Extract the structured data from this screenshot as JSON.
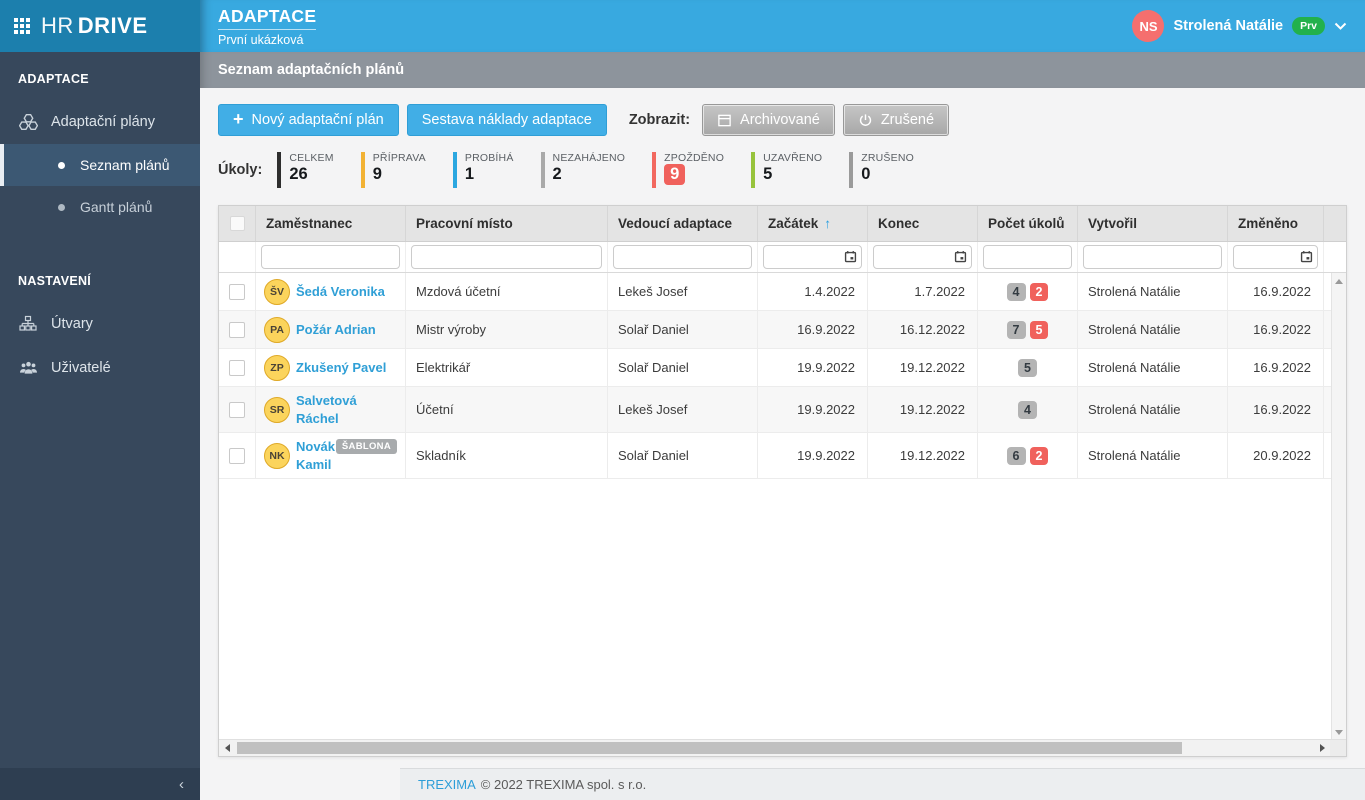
{
  "app": {
    "logo_primary": "HR",
    "logo_secondary": "DRIVE"
  },
  "sidebar": {
    "section_adaptace": "ADAPTACE",
    "item_plans": "Adaptační plány",
    "item_plan_list": "Seznam plánů",
    "item_gantt": "Gantt plánů",
    "section_nastaveni": "NASTAVENÍ",
    "item_utvary": "Útvary",
    "item_uzivatele": "Uživatelé"
  },
  "header": {
    "title": "ADAPTACE",
    "subtitle": "První ukázková",
    "user_initials": "NS",
    "user_name": "Strolená Natálie",
    "user_badge": "Prv"
  },
  "toolbar": {
    "title": "Seznam adaptačních plánů"
  },
  "actions": {
    "new_plan_icon": "+",
    "new_plan": "Nový adaptační plán",
    "report": "Sestava náklady adaptace",
    "show_label": "Zobrazit:",
    "archived": "Archivované",
    "cancelled": "Zrušené"
  },
  "task_summary": {
    "label": "Úkoly:",
    "highlight_color": "#f0615c",
    "counters": [
      {
        "label": "CELKEM",
        "value": "26",
        "color": "#2e2e2e",
        "highlight": false
      },
      {
        "label": "PŘÍPRAVA",
        "value": "9",
        "color": "#f2b234",
        "highlight": false
      },
      {
        "label": "PROBÍHÁ",
        "value": "1",
        "color": "#2ba7e0",
        "highlight": false
      },
      {
        "label": "NEZAHÁJENO",
        "value": "2",
        "color": "#a9a9a9",
        "highlight": false
      },
      {
        "label": "ZPOŽDĚNO",
        "value": "9",
        "color": "#f2685f",
        "highlight": true
      },
      {
        "label": "UZAVŘENO",
        "value": "5",
        "color": "#97c33c",
        "highlight": false
      },
      {
        "label": "ZRUŠENO",
        "value": "0",
        "color": "#9a9a9a",
        "highlight": false
      }
    ]
  },
  "table": {
    "columns": [
      "Zaměstnanec",
      "Pracovní místo",
      "Vedoucí adaptace",
      "Začátek",
      "Konec",
      "Počet úkolů",
      "Vytvořil",
      "Změněno"
    ],
    "sorted_column": "Začátek",
    "sort_direction": "asc",
    "rows": [
      {
        "initials": "ŠV",
        "name": "Šedá Veronika",
        "template": "",
        "position": "Mzdová účetní",
        "leader": "Lekeš Josef",
        "start": "1.4.2022",
        "end": "1.7.2022",
        "tasks_total": "4",
        "tasks_overdue": "2",
        "created_by": "Strolená Natálie",
        "changed": "16.9.2022"
      },
      {
        "initials": "PA",
        "name": "Požár Adrian",
        "template": "",
        "position": "Mistr výroby",
        "leader": "Solař Daniel",
        "start": "16.9.2022",
        "end": "16.12.2022",
        "tasks_total": "7",
        "tasks_overdue": "5",
        "created_by": "Strolená Natálie",
        "changed": "16.9.2022"
      },
      {
        "initials": "ZP",
        "name": "Zkušený Pavel",
        "template": "",
        "position": "Elektrikář",
        "leader": "Solař Daniel",
        "start": "19.9.2022",
        "end": "19.12.2022",
        "tasks_total": "5",
        "tasks_overdue": "",
        "created_by": "Strolená Natálie",
        "changed": "16.9.2022"
      },
      {
        "initials": "SR",
        "name": "Salvetová Ráchel",
        "template": "",
        "position": "Účetní",
        "leader": "Lekeš Josef",
        "start": "19.9.2022",
        "end": "19.12.2022",
        "tasks_total": "4",
        "tasks_overdue": "",
        "created_by": "Strolená Natálie",
        "changed": "16.9.2022"
      },
      {
        "initials": "NK",
        "name": "Novák Kamil",
        "template": "ŠABLONA",
        "position": "Skladník",
        "leader": "Solař Daniel",
        "start": "19.9.2022",
        "end": "19.12.2022",
        "tasks_total": "6",
        "tasks_overdue": "2",
        "created_by": "Strolená Natálie",
        "changed": "20.9.2022"
      }
    ]
  },
  "footer": {
    "link": "TREXIMA",
    "copyright": "© 2022 TREXIMA spol. s r.o."
  },
  "colors": {
    "accent_blue": "#38a9e0",
    "badge_gray": "#b4b4b4",
    "badge_red": "#f0615c",
    "avatar_yellow": "#fbd45c",
    "user_avatar_red": "#f56f6e",
    "user_badge_green": "#22b14c"
  }
}
